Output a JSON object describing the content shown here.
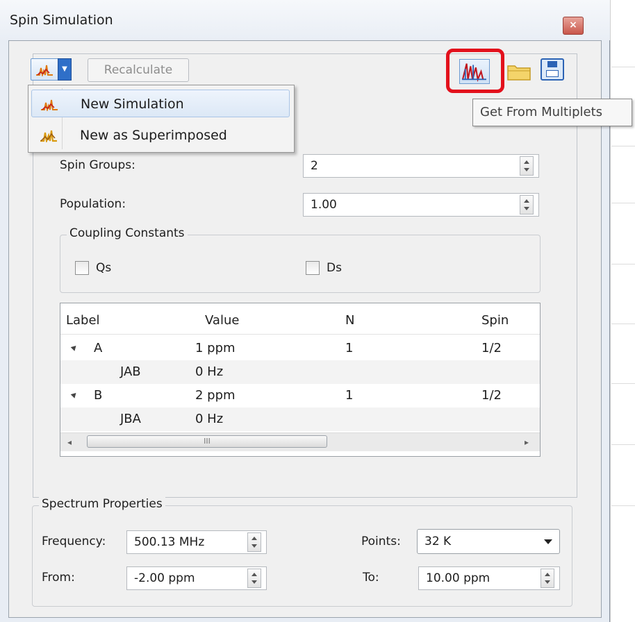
{
  "window": {
    "title": "Spin Simulation",
    "close_glyph": "×"
  },
  "toolbar": {
    "simulation_menu_icon": "spectrum-simulation-icon",
    "recalculate_label": "Recalculate",
    "get_from_multiplets_icon": "multiplets-icon",
    "open_icon": "folder-icon",
    "save_icon": "floppy-disk-icon",
    "tooltip": "Get From Multiplets",
    "highlight_color": "#e3101c"
  },
  "dropdown": {
    "items": [
      {
        "label": "New Simulation",
        "icon": "spectrum-simulation-icon"
      },
      {
        "label": "New as Superimposed",
        "icon": "superimposed-spectrum-icon"
      }
    ]
  },
  "spin": {
    "groups_label": "Spin Groups:",
    "groups_value": "2",
    "population_label": "Population:",
    "population_value": "1.00"
  },
  "coupling": {
    "title": "Coupling Constants",
    "qs_label": "Qs",
    "ds_label": "Ds"
  },
  "table": {
    "columns": [
      "Label",
      "Value",
      "N",
      "Spin"
    ],
    "rows": [
      {
        "label": "A",
        "value": "1 ppm",
        "n": "1",
        "spin": "1/2"
      },
      {
        "label": "JAB",
        "value": "0 Hz",
        "n": "",
        "spin": ""
      },
      {
        "label": "B",
        "value": "2 ppm",
        "n": "1",
        "spin": "1/2"
      },
      {
        "label": "JBA",
        "value": "0 Hz",
        "n": "",
        "spin": ""
      }
    ],
    "scroll_left": "◂",
    "scroll_right": "▸",
    "scroll_grip": "III"
  },
  "spectrum": {
    "title": "Spectrum Properties",
    "frequency_label": "Frequency:",
    "frequency_value": "500.13 MHz",
    "points_label": "Points:",
    "points_value": "32 K",
    "from_label": "From:",
    "from_value": "-2.00 ppm",
    "to_label": "To:",
    "to_value": "10.00 ppm"
  }
}
